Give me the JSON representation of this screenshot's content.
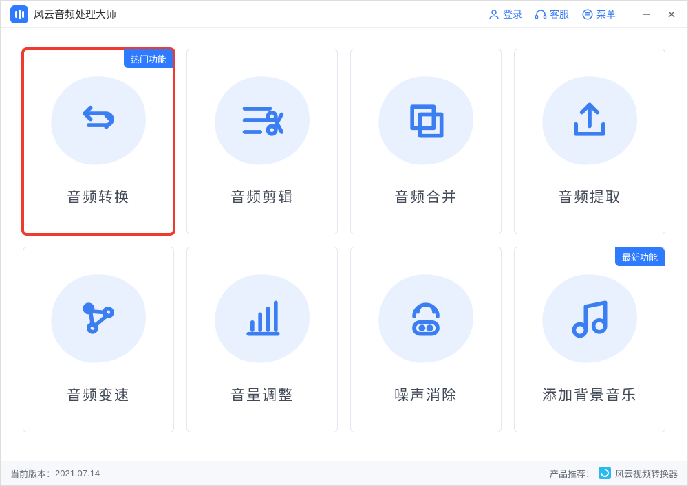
{
  "app_title": "风云音频处理大师",
  "header": {
    "login": "登录",
    "support": "客服",
    "menu": "菜单"
  },
  "cards": [
    {
      "label": "音频转换",
      "badge": "热门功能",
      "highlight": true
    },
    {
      "label": "音频剪辑"
    },
    {
      "label": "音频合并"
    },
    {
      "label": "音频提取"
    },
    {
      "label": "音频变速"
    },
    {
      "label": "音量调整"
    },
    {
      "label": "噪声消除"
    },
    {
      "label": "添加背景音乐",
      "badge": "最新功能"
    }
  ],
  "footer": {
    "version_label": "当前版本：",
    "version": "2021.07.14",
    "recommend_label": "产品推荐：",
    "recommend": "风云视频转换器"
  }
}
